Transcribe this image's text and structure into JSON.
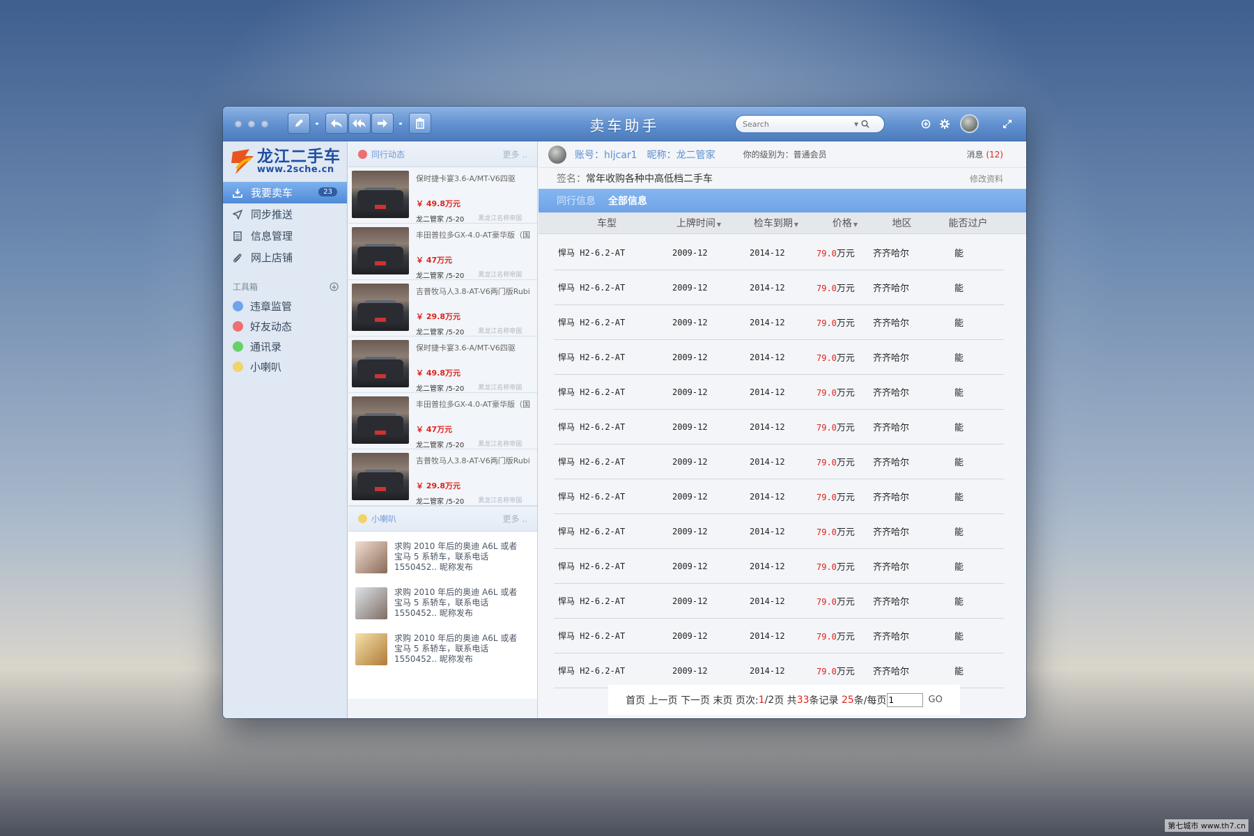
{
  "window": {
    "title": "卖车助手",
    "search_placeholder": "Search"
  },
  "sidebar": {
    "logo_cn": "龙江二手车",
    "logo_url": "www.2sche.cn",
    "nav": [
      {
        "label": "我要卖车",
        "icon": "download-icon",
        "badge": "23",
        "active": true
      },
      {
        "label": "同步推送",
        "icon": "send-icon"
      },
      {
        "label": "信息管理",
        "icon": "document-icon"
      },
      {
        "label": "网上店铺",
        "icon": "paperclip-icon"
      }
    ],
    "tools_title": "工具箱",
    "tools": [
      {
        "label": "违章监管",
        "color": "#6fa3ea"
      },
      {
        "label": "好友动态",
        "color": "#ee6f6f"
      },
      {
        "label": "通讯录",
        "color": "#67d06a"
      },
      {
        "label": "小喇叭",
        "color": "#f0d36a"
      }
    ]
  },
  "feed": {
    "peer_title": "同行动态",
    "peer_more": "更多 ..",
    "cars": [
      {
        "title": "保时捷卡宴3.6-A/MT-V6四驱",
        "price": "￥ 49.8万元",
        "seller": "龙二管家 /5-20",
        "region": "黑龙江名称帝国"
      },
      {
        "title": "丰田普拉多GX-4.0-AT豪华版（国",
        "price": "￥ 47万元",
        "seller": "龙二管家 /5-20",
        "region": "黑龙江名称帝国"
      },
      {
        "title": "吉普牧马人3.8-AT-V6两门版Rubi",
        "price": "￥ 29.8万元",
        "seller": "龙二管家 /5-20",
        "region": "黑龙江名称帝国"
      },
      {
        "title": "保时捷卡宴3.6-A/MT-V6四驱",
        "price": "￥ 49.8万元",
        "seller": "龙二管家 /5-20",
        "region": "黑龙江名称帝国"
      },
      {
        "title": "丰田普拉多GX-4.0-AT豪华版（国",
        "price": "￥ 47万元",
        "seller": "龙二管家 /5-20",
        "region": "黑龙江名称帝国"
      },
      {
        "title": "吉普牧马人3.8-AT-V6两门版Rubi",
        "price": "￥ 29.8万元",
        "seller": "龙二管家 /5-20",
        "region": "黑龙江名称帝国"
      }
    ],
    "horn_title": "小喇叭",
    "horn_more": "更多 ..",
    "horn": [
      "求购 2010 年后的奥迪 A6L 或者宝马 5 系轿车，联系电话 1550452.. 昵称发布",
      "求购 2010 年后的奥迪 A6L 或者宝马 5 系轿车，联系电话 1550452.. 昵称发布",
      "求购 2010 年后的奥迪 A6L 或者宝马 5 系轿车，联系电话 1550452.. 昵称发布"
    ]
  },
  "profile": {
    "account": "账号：hljcar1",
    "nickname": "昵称：龙二管家",
    "level": "你的级别为：普通会员",
    "messages_label": "消息",
    "messages_count": "(12)",
    "signature_label": "签名：",
    "signature": "常年收购各种中高低档二手车",
    "edit": "修改资料"
  },
  "tabs": [
    "同行信息",
    "全部信息"
  ],
  "table": {
    "headers": [
      "车型",
      "上牌时间",
      "检车到期",
      "价格",
      "地区",
      "能否过户"
    ],
    "rows": [
      [
        "悍马 H2-6.2-AT",
        "2009-12",
        "2014-12",
        "79.0",
        "万元",
        "齐齐哈尔",
        "能"
      ],
      [
        "悍马 H2-6.2-AT",
        "2009-12",
        "2014-12",
        "79.0",
        "万元",
        "齐齐哈尔",
        "能"
      ],
      [
        "悍马 H2-6.2-AT",
        "2009-12",
        "2014-12",
        "79.0",
        "万元",
        "齐齐哈尔",
        "能"
      ],
      [
        "悍马 H2-6.2-AT",
        "2009-12",
        "2014-12",
        "79.0",
        "万元",
        "齐齐哈尔",
        "能"
      ],
      [
        "悍马 H2-6.2-AT",
        "2009-12",
        "2014-12",
        "79.0",
        "万元",
        "齐齐哈尔",
        "能"
      ],
      [
        "悍马 H2-6.2-AT",
        "2009-12",
        "2014-12",
        "79.0",
        "万元",
        "齐齐哈尔",
        "能"
      ],
      [
        "悍马 H2-6.2-AT",
        "2009-12",
        "2014-12",
        "79.0",
        "万元",
        "齐齐哈尔",
        "能"
      ],
      [
        "悍马 H2-6.2-AT",
        "2009-12",
        "2014-12",
        "79.0",
        "万元",
        "齐齐哈尔",
        "能"
      ],
      [
        "悍马 H2-6.2-AT",
        "2009-12",
        "2014-12",
        "79.0",
        "万元",
        "齐齐哈尔",
        "能"
      ],
      [
        "悍马 H2-6.2-AT",
        "2009-12",
        "2014-12",
        "79.0",
        "万元",
        "齐齐哈尔",
        "能"
      ],
      [
        "悍马 H2-6.2-AT",
        "2009-12",
        "2014-12",
        "79.0",
        "万元",
        "齐齐哈尔",
        "能"
      ],
      [
        "悍马 H2-6.2-AT",
        "2009-12",
        "2014-12",
        "79.0",
        "万元",
        "齐齐哈尔",
        "能"
      ],
      [
        "悍马 H2-6.2-AT",
        "2009-12",
        "2014-12",
        "79.0",
        "万元",
        "齐齐哈尔",
        "能"
      ]
    ]
  },
  "pager": {
    "first": "首页",
    "prev": "上一页",
    "next": "下一页",
    "last": "末页",
    "page_label": "页次:",
    "page_current": "1",
    "page_total": "/2",
    "page_suffix": "页 共",
    "records": "33",
    "records_suffix": "条记录",
    "per_page": "25",
    "per_page_suffix": "条/每页",
    "input_value": "1",
    "go": "GO"
  },
  "watermark": "第七城市 www.th7.cn"
}
